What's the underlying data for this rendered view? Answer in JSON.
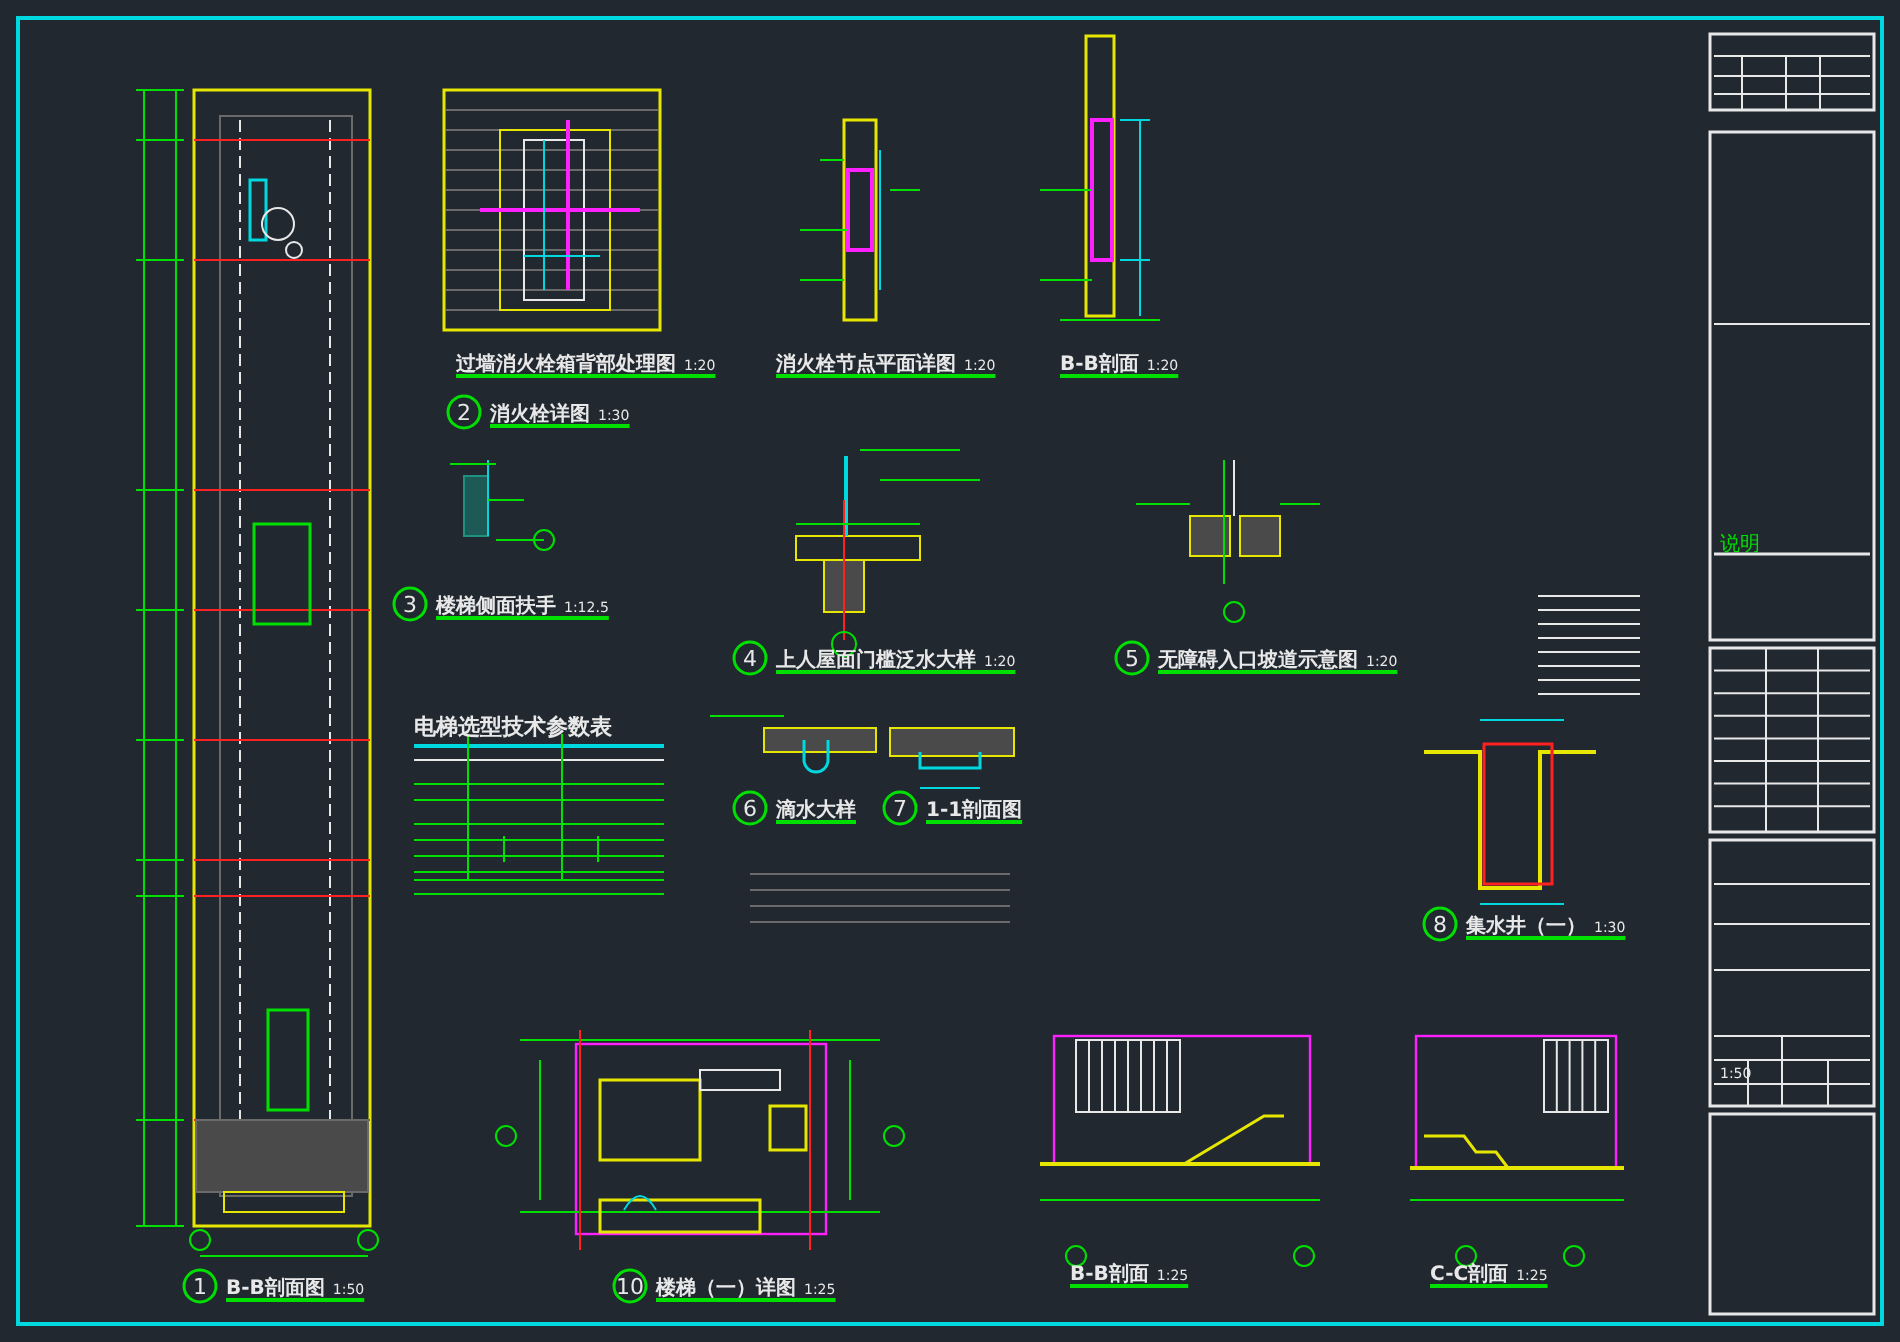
{
  "details": [
    {
      "title": "过墙消火栓箱背部处理图",
      "scale": "1:20"
    },
    {
      "title": "消火栓节点平面详图",
      "scale": "1:20"
    },
    {
      "title": "B-B剖面",
      "scale": "1:20"
    },
    {
      "number": "2",
      "title": "消火栓详图",
      "scale": "1:30"
    },
    {
      "number": "3",
      "title": "楼梯侧面扶手",
      "scale": "1:12.5"
    },
    {
      "number": "4",
      "title": "上人屋面门槛泛水大样",
      "scale": "1:20"
    },
    {
      "number": "5",
      "title": "无障碍入口坡道示意图",
      "scale": "1:20"
    },
    {
      "number": "6",
      "title": "滴水大样"
    },
    {
      "number": "7",
      "title": "1-1剖面图"
    },
    {
      "number": "8",
      "title": "集水井（一）",
      "scale": "1:30"
    },
    {
      "number": "1",
      "title": "B-B剖面图",
      "scale": "1:50"
    },
    {
      "number": "10",
      "title": "楼梯（一）详图",
      "scale": "1:25"
    },
    {
      "title": "B-B剖面",
      "scale": "1:25"
    },
    {
      "title": "C-C剖面",
      "scale": "1:25"
    }
  ],
  "parameter_table": {
    "title": "电梯选型技术参数表"
  },
  "title_block": {
    "note": "说明",
    "scale": "1:50"
  }
}
